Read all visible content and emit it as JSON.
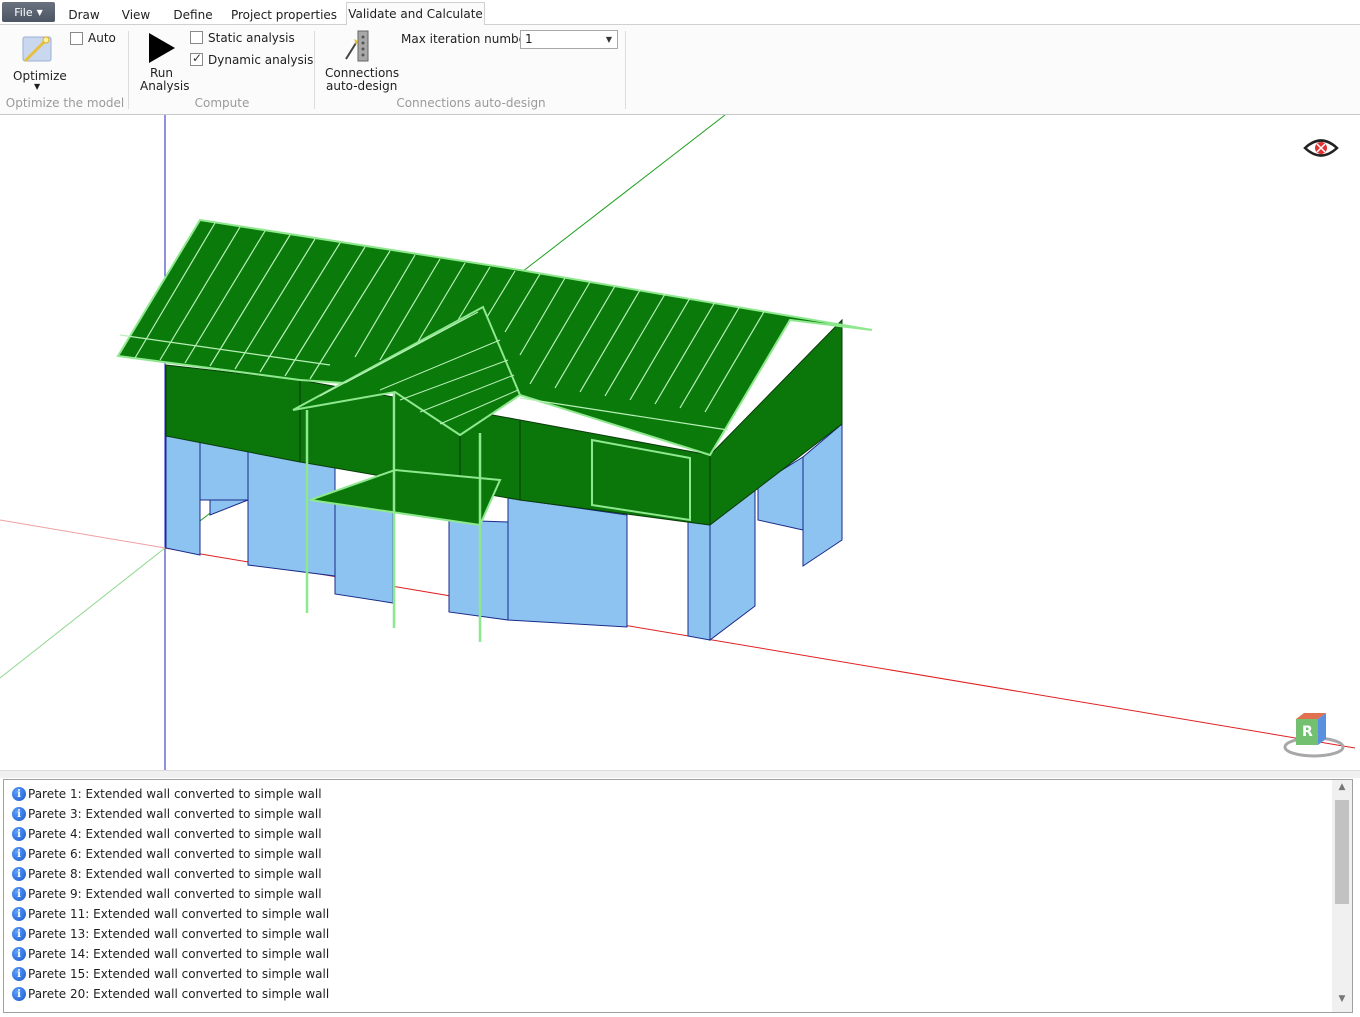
{
  "tabs": {
    "file": "File",
    "draw": "Draw",
    "view": "View",
    "define": "Define",
    "project_properties": "Project properties",
    "validate": "Validate and Calculate"
  },
  "ribbon": {
    "optimize_group": {
      "optimize_label": "Optimize",
      "auto_label": "Auto",
      "auto_checked": false,
      "group_label": "Optimize the model"
    },
    "compute_group": {
      "run_label_1": "Run",
      "run_label_2": "Analysis",
      "static_label": "Static analysis",
      "static_checked": false,
      "dynamic_label": "Dynamic analysis",
      "dynamic_checked": true,
      "group_label": "Compute"
    },
    "connections_group": {
      "connections_label_1": "Connections",
      "connections_label_2": "auto-design",
      "max_iteration_label": "Max iteration number",
      "max_iteration_value": "1",
      "group_label": "Connections auto-design"
    }
  },
  "viewport": {
    "nav_cube_face": "R",
    "icons": [
      "visibility-off-icon",
      "navigation-cube-icon"
    ],
    "colors": {
      "roof": "#0a7a0a",
      "upper_wall": "#0b770b",
      "lower_wall": "#8cc3f0",
      "edge": "#8ee88e",
      "axis_x": "#e02020",
      "axis_y": "#20a020",
      "axis_z": "#2020c0"
    }
  },
  "log": {
    "messages": [
      "Parete 1: Extended wall converted to simple wall",
      "Parete 3: Extended wall converted to simple wall",
      "Parete 4: Extended wall converted to simple wall",
      "Parete 6: Extended wall converted to simple wall",
      "Parete 8: Extended wall converted to simple wall",
      "Parete 9: Extended wall converted to simple wall",
      "Parete 11: Extended wall converted to simple wall",
      "Parete 13: Extended wall converted to simple wall",
      "Parete 14: Extended wall converted to simple wall",
      "Parete 15: Extended wall converted to simple wall",
      "Parete 20: Extended wall converted to simple wall"
    ],
    "icon": "info-icon"
  }
}
